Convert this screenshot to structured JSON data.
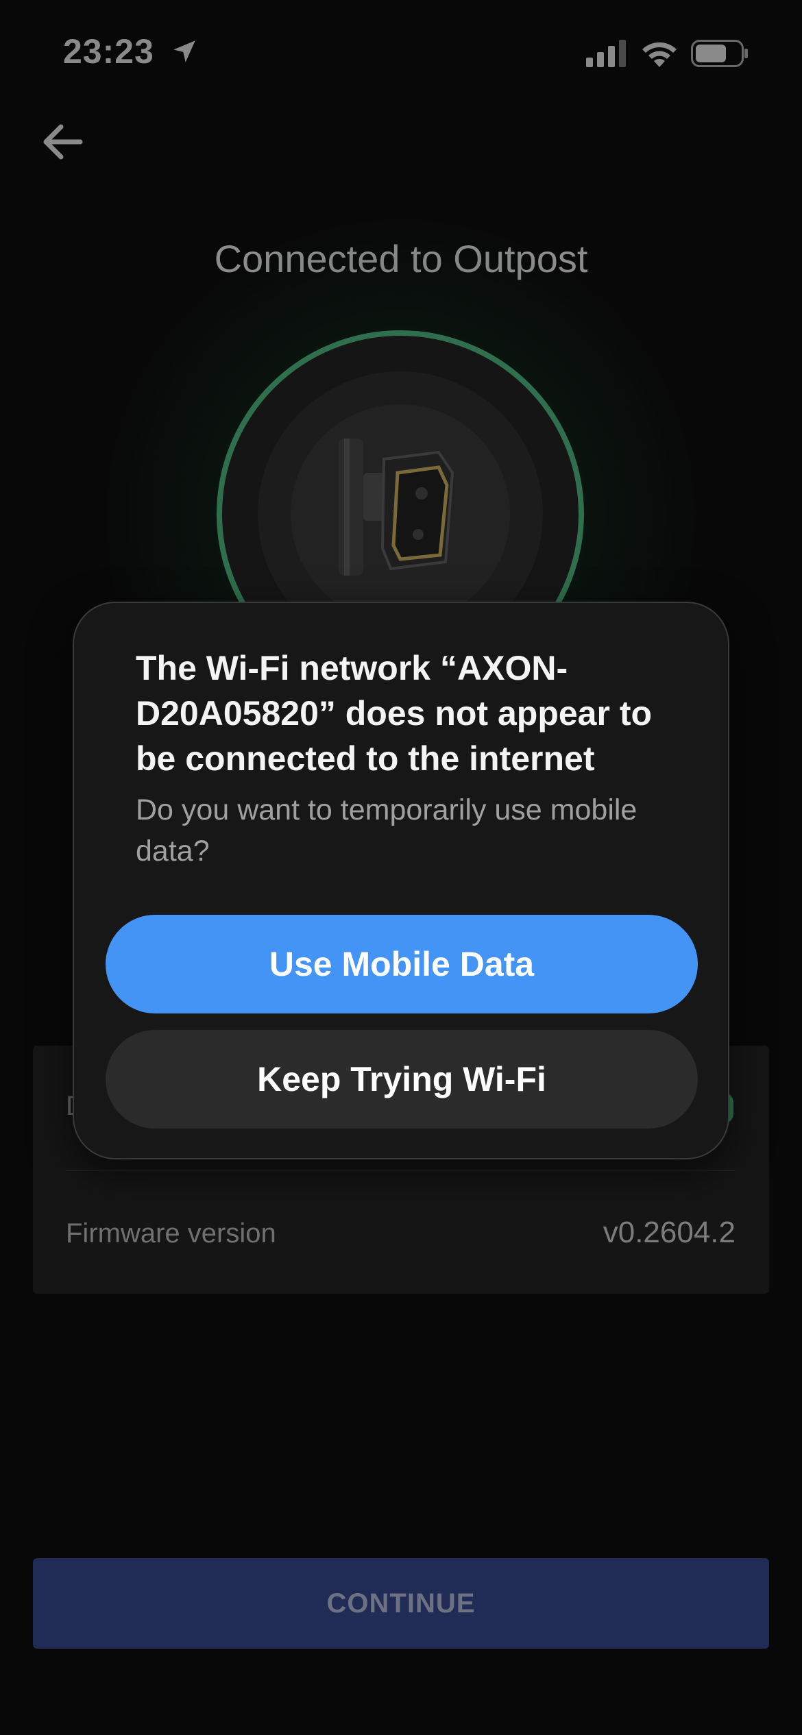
{
  "status_bar": {
    "time": "23:23",
    "icons": [
      "location-arrow-icon",
      "cellular-signal-icon",
      "wifi-icon",
      "battery-icon"
    ]
  },
  "header": {
    "back_icon": "arrow-left-icon",
    "title": "Connected to Outpost"
  },
  "device": {
    "image": "camera-device-icon",
    "ring_color": "#2f6f4d"
  },
  "info_card": {
    "row1_label_partial": "D",
    "firmware_label": "Firmware version",
    "firmware_value": "v0.2604.2"
  },
  "alert": {
    "title": "The Wi-Fi network “AXON-D20A05820” does not appear to be connected to the internet",
    "message": "Do you want to temporarily use mobile data?",
    "primary_button": "Use Mobile Data",
    "secondary_button": "Keep Trying Wi-Fi",
    "primary_color": "#4494f6"
  },
  "footer": {
    "continue_label": "CONTINUE"
  }
}
